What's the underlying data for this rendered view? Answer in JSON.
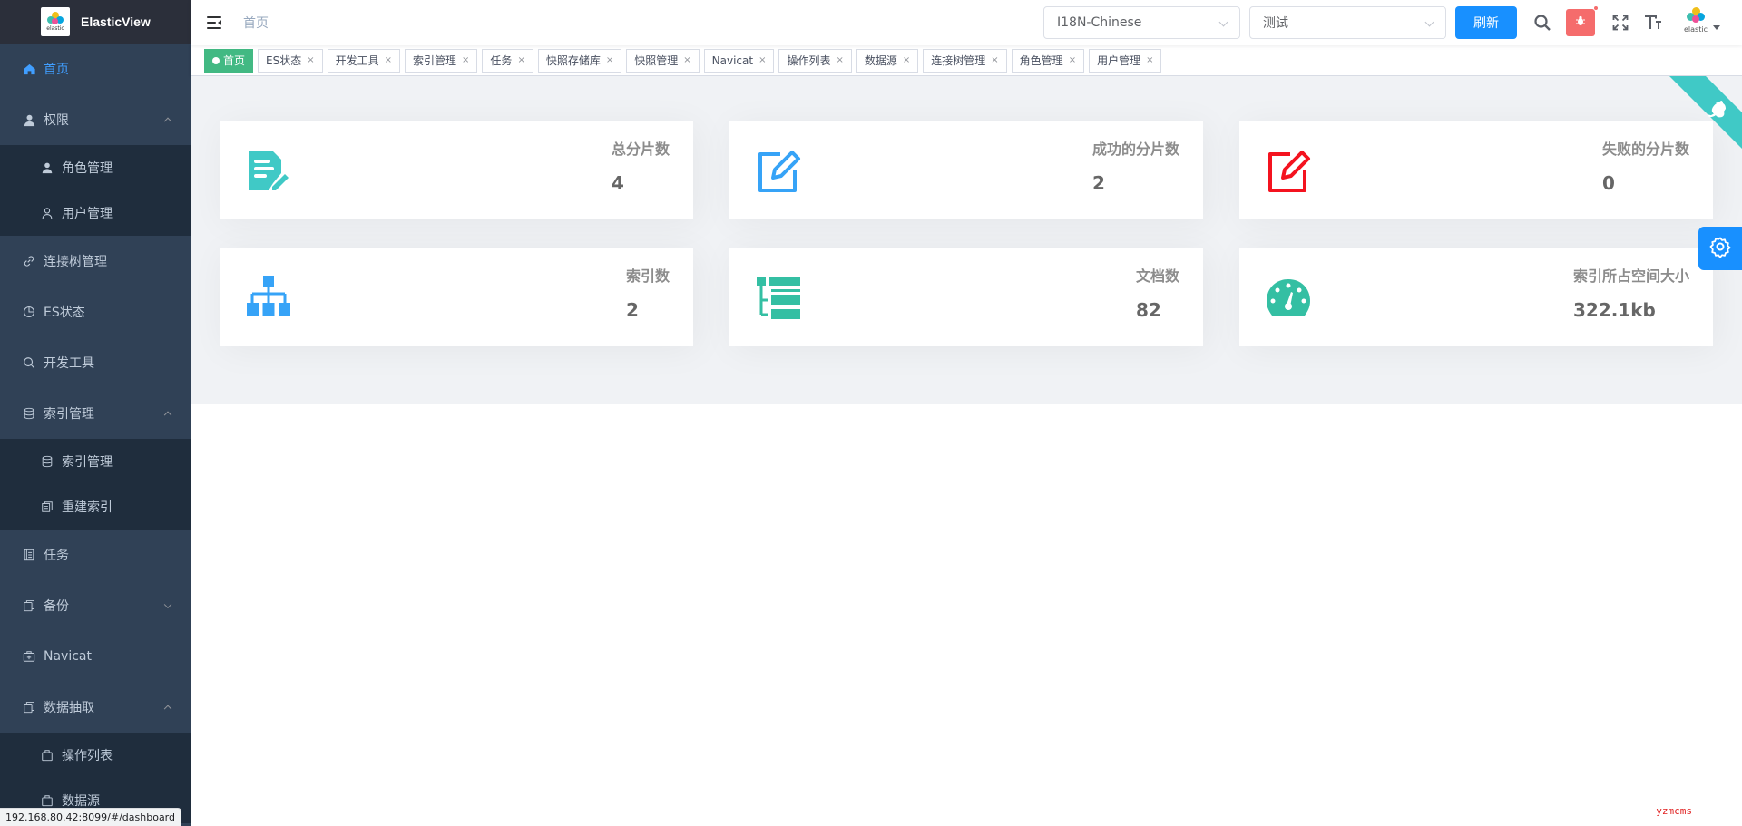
{
  "app": {
    "title": "ElasticView",
    "logo_caption": "elastic"
  },
  "sidebar": {
    "items": [
      {
        "label": "首页",
        "icon": "home-icon",
        "active": true
      },
      {
        "label": "权限",
        "icon": "user-icon",
        "expanded": true,
        "children": [
          {
            "label": "角色管理",
            "icon": "user-solid-icon"
          },
          {
            "label": "用户管理",
            "icon": "user-outline-icon"
          }
        ]
      },
      {
        "label": "连接树管理",
        "icon": "link-icon"
      },
      {
        "label": "ES状态",
        "icon": "pie-chart-icon"
      },
      {
        "label": "开发工具",
        "icon": "search-icon"
      },
      {
        "label": "索引管理",
        "icon": "database-icon",
        "expanded": true,
        "children": [
          {
            "label": "索引管理",
            "icon": "database-icon"
          },
          {
            "label": "重建索引",
            "icon": "copy-icon"
          }
        ]
      },
      {
        "label": "任务",
        "icon": "tickets-icon"
      },
      {
        "label": "备份",
        "icon": "copy-document-icon",
        "expanded": false
      },
      {
        "label": "Navicat",
        "icon": "first-aid-kit-icon"
      },
      {
        "label": "数据抽取",
        "icon": "copy-document-icon",
        "expanded": true,
        "children": [
          {
            "label": "操作列表",
            "icon": "suitcase-icon"
          },
          {
            "label": "数据源",
            "icon": "suitcase-icon"
          }
        ]
      }
    ]
  },
  "navbar": {
    "breadcrumb": "首页",
    "language_select": "I18N-Chinese",
    "connection_select": "测试",
    "refresh_label": "刷新",
    "avatar_caption": "elastic"
  },
  "tags": [
    {
      "label": "首页",
      "active": true
    },
    {
      "label": "ES状态"
    },
    {
      "label": "开发工具"
    },
    {
      "label": "索引管理"
    },
    {
      "label": "任务"
    },
    {
      "label": "快照存储库"
    },
    {
      "label": "快照管理"
    },
    {
      "label": "Navicat"
    },
    {
      "label": "操作列表"
    },
    {
      "label": "数据源"
    },
    {
      "label": "连接树管理"
    },
    {
      "label": "角色管理"
    },
    {
      "label": "用户管理"
    }
  ],
  "tag_close_glyph": "×",
  "stats": [
    {
      "label": "总分片数",
      "value": "4",
      "icon": "document-edit-icon",
      "color": "#40c9c6"
    },
    {
      "label": "成功的分片数",
      "value": "2",
      "icon": "edit-square-icon",
      "color": "#36a3f7"
    },
    {
      "label": "失败的分片数",
      "value": "0",
      "icon": "edit-square-icon",
      "color": "#f4131f"
    },
    {
      "label": "索引数",
      "value": "2",
      "icon": "tree-structure-icon",
      "color": "#36a3f7"
    },
    {
      "label": "文档数",
      "value": "82",
      "icon": "tree-table-icon",
      "color": "#34bfa3"
    },
    {
      "label": "索引所占空间大小",
      "value": "322.1kb",
      "icon": "dashboard-gauge-icon",
      "color": "#34bfa3"
    }
  ],
  "status_bar": {
    "url": "192.168.80.42:8099/#/dashboard"
  },
  "watermark": "yzmcms"
}
